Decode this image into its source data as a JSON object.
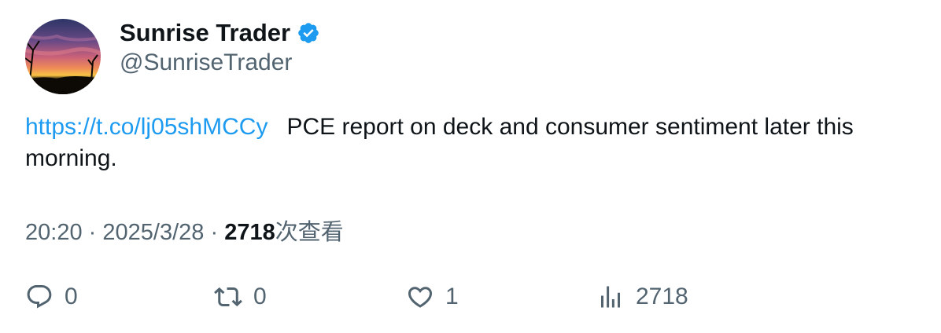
{
  "author": {
    "display_name": "Sunrise Trader",
    "handle": "@SunriseTrader",
    "verified": true,
    "verified_color": "#1d9bf0"
  },
  "tweet": {
    "link": "https://t.co/lj05shMCCy",
    "text": "PCE report on deck and consumer sentiment later this morning."
  },
  "meta": {
    "time": "20:20",
    "separator1": "·",
    "date": "2025/3/28",
    "separator2": "·",
    "views": "2718",
    "views_label": "次查看"
  },
  "actions": {
    "reply": {
      "icon": "reply-icon",
      "count": "0"
    },
    "retweet": {
      "icon": "retweet-icon",
      "count": "0"
    },
    "like": {
      "icon": "heart-icon",
      "count": "1"
    },
    "views": {
      "icon": "analytics-icon",
      "count": "2718"
    }
  },
  "colors": {
    "text": "#0f1419",
    "secondary": "#536471",
    "link": "#1d9bf0"
  }
}
